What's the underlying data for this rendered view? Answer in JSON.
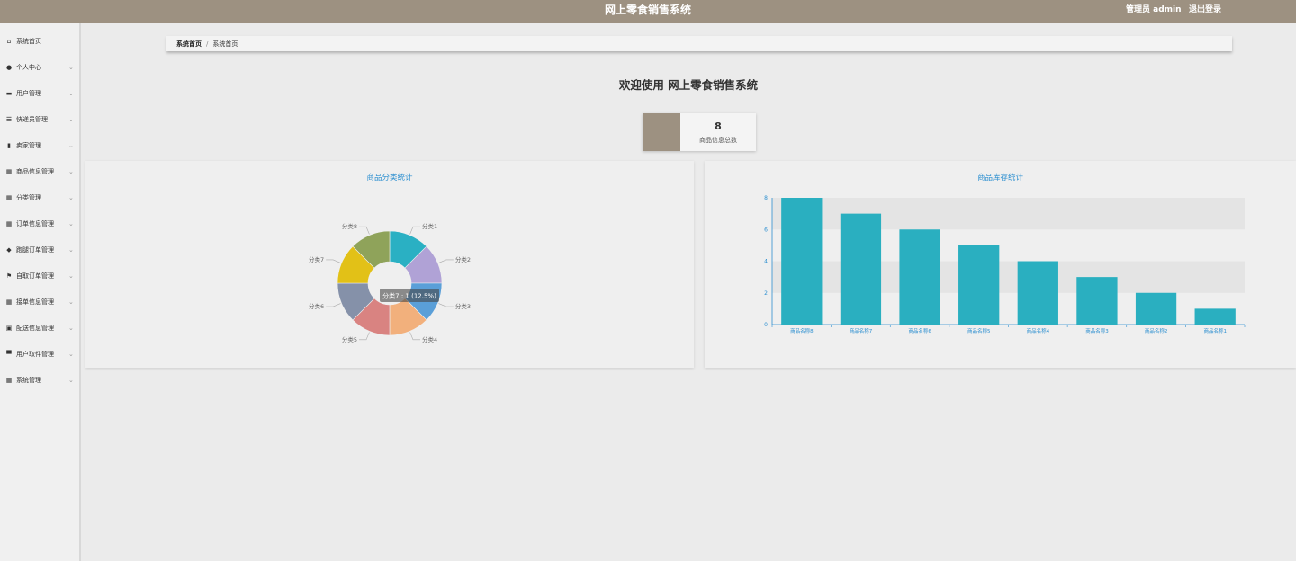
{
  "header": {
    "title": "网上零食销售系统",
    "user": "管理员 admin",
    "logout": "退出登录"
  },
  "sidebar": {
    "items": [
      {
        "label": "系统首页",
        "icon": "home-icon",
        "arrow": false
      },
      {
        "label": "个人中心",
        "icon": "user-icon",
        "arrow": true
      },
      {
        "label": "用户管理",
        "icon": "users-icon",
        "arrow": true
      },
      {
        "label": "快递员管理",
        "icon": "list-icon",
        "arrow": true
      },
      {
        "label": "卖家管理",
        "icon": "chart-icon",
        "arrow": true
      },
      {
        "label": "商品信息管理",
        "icon": "grid-icon",
        "arrow": true
      },
      {
        "label": "分类管理",
        "icon": "grid-icon",
        "arrow": true
      },
      {
        "label": "订单信息管理",
        "icon": "grid-icon",
        "arrow": true
      },
      {
        "label": "跑腿订单管理",
        "icon": "location-icon",
        "arrow": true
      },
      {
        "label": "自取订单管理",
        "icon": "flag-icon",
        "arrow": true
      },
      {
        "label": "接单信息管理",
        "icon": "grid-icon",
        "arrow": true
      },
      {
        "label": "配送信息管理",
        "icon": "package-icon",
        "arrow": true
      },
      {
        "label": "用户取件管理",
        "icon": "monitor-icon",
        "arrow": true
      },
      {
        "label": "系统管理",
        "icon": "grid-icon",
        "arrow": true
      }
    ]
  },
  "breadcrumb": {
    "home": "系统首页",
    "current": "系统首页"
  },
  "welcome": "欢迎使用 网上零食销售系统",
  "stat": {
    "value": "8",
    "label": "商品信息总数"
  },
  "colors": {
    "header": "#9d9181",
    "accent": "#2c8fd0",
    "bar": "#2aafc0"
  },
  "chart_data": [
    {
      "type": "pie",
      "title": "商品分类统计",
      "slices": [
        {
          "name": "分类1",
          "value": 1,
          "color": "#2ab0c3"
        },
        {
          "name": "分类2",
          "value": 1,
          "color": "#b0a2d6"
        },
        {
          "name": "分类3",
          "value": 1,
          "color": "#5a9fd8"
        },
        {
          "name": "分类4",
          "value": 1,
          "color": "#f2b07c"
        },
        {
          "name": "分类5",
          "value": 1,
          "color": "#d98381"
        },
        {
          "name": "分类6",
          "value": 1,
          "color": "#8591a9"
        },
        {
          "name": "分类7",
          "value": 1,
          "color": "#e2c117"
        },
        {
          "name": "分类8",
          "value": 1,
          "color": "#8fa35a"
        }
      ],
      "tooltip": "分类7 : 1 (12.5%)"
    },
    {
      "type": "bar",
      "title": "商品库存统计",
      "categories": [
        "商品名称8",
        "商品名称7",
        "商品名称6",
        "商品名称5",
        "商品名称4",
        "商品名称3",
        "商品名称2",
        "商品名称1"
      ],
      "values": [
        8,
        7,
        6,
        5,
        4,
        3,
        2,
        1
      ],
      "ylim": [
        0,
        8
      ],
      "yticks": [
        "0",
        "2",
        "4",
        "6",
        "8"
      ]
    }
  ]
}
